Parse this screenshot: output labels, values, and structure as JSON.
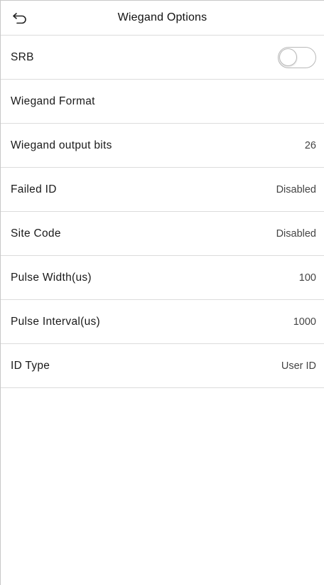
{
  "header": {
    "title": "Wiegand Options",
    "back_icon": "back-arrow-icon"
  },
  "rows": [
    {
      "label": "SRB",
      "type": "toggle",
      "toggle_on": false
    },
    {
      "label": "Wiegand Format",
      "value": ""
    },
    {
      "label": "Wiegand output bits",
      "value": "26"
    },
    {
      "label": "Failed ID",
      "value": "Disabled"
    },
    {
      "label": "Site Code",
      "value": "Disabled"
    },
    {
      "label": "Pulse Width(us)",
      "value": "100"
    },
    {
      "label": "Pulse Interval(us)",
      "value": "1000"
    },
    {
      "label": "ID Type",
      "value": "User ID"
    }
  ],
  "colors": {
    "background": "#ffffff",
    "divider": "#dcdcdc",
    "text": "#1a1a1a"
  }
}
